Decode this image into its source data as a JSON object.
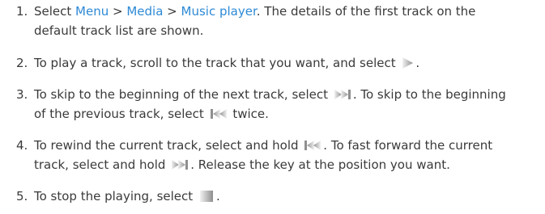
{
  "steps": [
    {
      "num": "1.",
      "t1": "Select ",
      "link1": "Menu",
      "sep1": " > ",
      "link2": "Media",
      "sep2": " > ",
      "link3": "Music player",
      "t2": ". The details of the first track on the",
      "t3": "default track list are shown."
    },
    {
      "num": "2.",
      "t1": "To play a track, scroll to the track that you want, and select ",
      "t2": "."
    },
    {
      "num": "3.",
      "t1": "To skip to the beginning of the next track, select ",
      "t2": ". To skip to the beginning",
      "t3": "of the previous track, select ",
      "t4": " twice."
    },
    {
      "num": "4.",
      "t1": "To rewind the current track, select and hold ",
      "t2": ". To fast forward the current",
      "t3": "track, select and hold ",
      "t4": ". Release the key at the position you want."
    },
    {
      "num": "5.",
      "t1": "To stop the playing, select ",
      "t2": "."
    }
  ],
  "colors": {
    "link": "#2e8ad6",
    "text": "#3a3a3a",
    "icon_gradient_start": "#f4f4f4",
    "icon_gradient_end": "#9a9a9a"
  },
  "icons": [
    "play-icon",
    "next-track-icon",
    "previous-track-icon",
    "rewind-icon",
    "fast-forward-icon",
    "stop-icon"
  ]
}
